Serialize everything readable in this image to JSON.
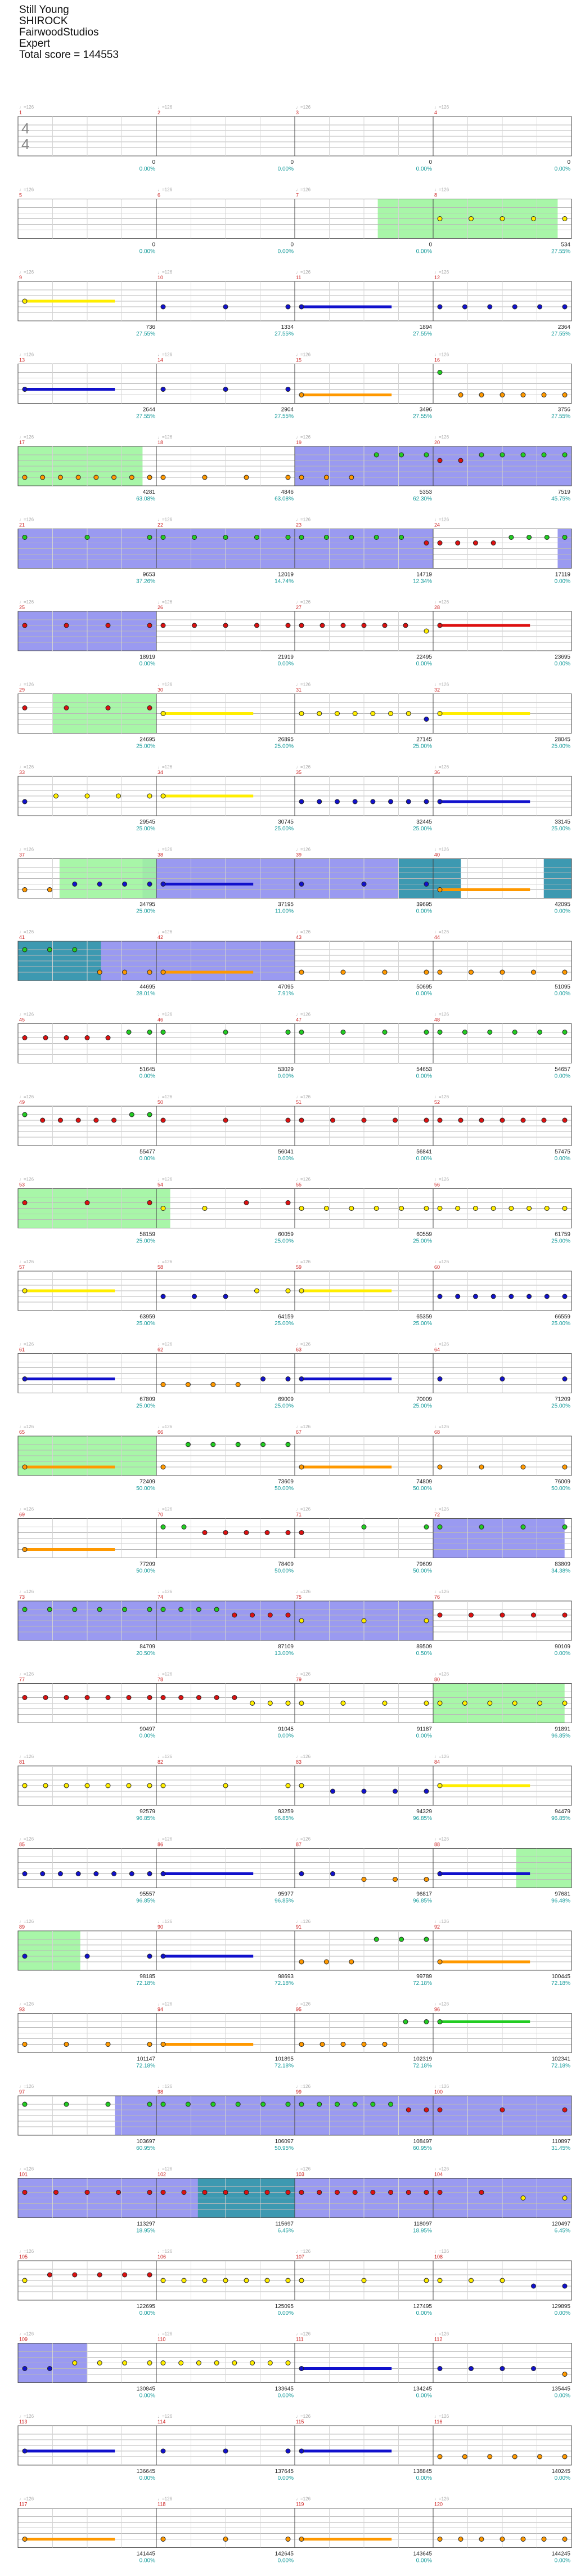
{
  "header": {
    "song_title": "Still Young",
    "artist": "SHIROCK",
    "charter": "FairwoodStudios",
    "difficulty": "Expert",
    "total_score": "Total score = 144553"
  },
  "colors": {
    "green": "#22cc22",
    "red": "#dd1111",
    "yellow": "#ffee00",
    "blue": "#1111cc",
    "orange": "#ff9900",
    "star_power": "#9ef59e",
    "solo": "#8888ee",
    "solo_star": "#3399aa",
    "label_num": "#cc2222",
    "label_bpm": "#aaaaaa",
    "score": "#222222",
    "pct": "#129999"
  },
  "chart_data": {
    "type": "guitar-hero-chart-highway",
    "time_signature": "4/4",
    "measures": [
      {
        "n": 1,
        "bpm": "♩=126",
        "score": "0",
        "pct": "0.00%"
      },
      {
        "n": 2,
        "score": "0",
        "pct": "0.00%"
      },
      {
        "n": 3,
        "bpm": "♩=126",
        "score": "0",
        "pct": "0.00%"
      },
      {
        "n": 4,
        "score": "0",
        "pct": "0.00%"
      },
      {
        "n": 5,
        "score": "0",
        "pct": "0.00%"
      },
      {
        "n": 6,
        "score": "0",
        "pct": "0.00%"
      },
      {
        "n": 7,
        "score": "0",
        "pct": "0.00%"
      },
      {
        "n": 8,
        "score": "534",
        "pct": "27.55%"
      },
      {
        "n": 9,
        "score": "736",
        "pct": "27.55%"
      },
      {
        "n": 10,
        "score": "1334",
        "pct": "27.55%"
      },
      {
        "n": 11,
        "score": "1894",
        "pct": "27.55%"
      },
      {
        "n": 12,
        "score": "2364",
        "pct": "27.55%"
      },
      {
        "n": 13,
        "score": "2644",
        "pct": "27.55%"
      },
      {
        "n": 14,
        "score": "2904",
        "pct": "27.55%"
      },
      {
        "n": 15,
        "score": "3496",
        "pct": "27.55%"
      },
      {
        "n": 16,
        "score": "3756",
        "pct": "27.55%"
      },
      {
        "n": 17,
        "score": "4281",
        "pct": "63.08%"
      },
      {
        "n": 18,
        "score": "4846",
        "pct": "63.08%"
      },
      {
        "n": 19,
        "score": "5353",
        "pct": "62.30%"
      },
      {
        "n": 20,
        "score": "7519",
        "pct": "45.75%"
      },
      {
        "n": 21,
        "score": "9653",
        "pct": "37.26%"
      },
      {
        "n": 22,
        "score": "12019",
        "pct": "14.74%"
      },
      {
        "n": 23,
        "score": "14719",
        "pct": "12.34%"
      },
      {
        "n": 24,
        "score": "17119",
        "pct": "0.00%"
      },
      {
        "n": 25,
        "score": "18919",
        "pct": "0.00%"
      },
      {
        "n": 26,
        "score": "21919",
        "pct": "0.00%"
      },
      {
        "n": 27,
        "score": "22495",
        "pct": "0.00%"
      },
      {
        "n": 28,
        "score": "23695",
        "pct": "0.00%"
      },
      {
        "n": 29,
        "score": "24695",
        "pct": "25.00%"
      },
      {
        "n": 30,
        "score": "26895",
        "pct": "25.00%"
      },
      {
        "n": 31,
        "score": "27145",
        "pct": "25.00%"
      },
      {
        "n": 32,
        "score": "28045",
        "pct": "25.00%"
      },
      {
        "n": 33,
        "score": "29545",
        "pct": "25.00%"
      },
      {
        "n": 34,
        "score": "30745",
        "pct": "25.00%"
      },
      {
        "n": 35,
        "score": "32445",
        "pct": "25.00%"
      },
      {
        "n": 36,
        "score": "33145",
        "pct": "25.00%"
      },
      {
        "n": 37,
        "score": "34795",
        "pct": "25.00%"
      },
      {
        "n": 38,
        "score": "37195",
        "pct": "11.00%"
      },
      {
        "n": 39,
        "score": "39695",
        "pct": "0.00%"
      },
      {
        "n": 40,
        "score": "42095",
        "pct": "0.00%"
      },
      {
        "n": 41,
        "score": "44695",
        "pct": "28.01%"
      },
      {
        "n": 42,
        "score": "47095",
        "pct": "7.91%"
      },
      {
        "n": 43,
        "score": "50695",
        "pct": "0.00%"
      },
      {
        "n": 44,
        "score": "51095",
        "pct": "0.00%"
      },
      {
        "n": 45,
        "score": "51645",
        "pct": "0.00%"
      },
      {
        "n": 46,
        "score": "53029",
        "pct": "0.00%"
      },
      {
        "n": 47,
        "score": "54653",
        "pct": "0.00%"
      },
      {
        "n": 48,
        "score": "54657",
        "pct": "0.00%"
      },
      {
        "n": 49,
        "score": "55477",
        "pct": "0.00%"
      },
      {
        "n": 50,
        "score": "56041",
        "pct": "0.00%"
      },
      {
        "n": 51,
        "score": "56841",
        "pct": "0.00%"
      },
      {
        "n": 52,
        "score": "57475",
        "pct": "0.00%"
      },
      {
        "n": 53,
        "score": "58159",
        "pct": "25.00%"
      },
      {
        "n": 54,
        "score": "60059",
        "pct": "25.00%"
      },
      {
        "n": 55,
        "score": "60559",
        "pct": "25.00%"
      },
      {
        "n": 56,
        "score": "61759",
        "pct": "25.00%"
      },
      {
        "n": 57,
        "score": "63959",
        "pct": "25.00%"
      },
      {
        "n": 58,
        "score": "64159",
        "pct": "25.00%"
      },
      {
        "n": 59,
        "score": "65359",
        "pct": "25.00%"
      },
      {
        "n": 60,
        "score": "66559",
        "pct": "25.00%"
      },
      {
        "n": 61,
        "score": "67809",
        "pct": "25.00%"
      },
      {
        "n": 62,
        "score": "69009",
        "pct": "25.00%"
      },
      {
        "n": 63,
        "score": "70009",
        "pct": "25.00%"
      },
      {
        "n": 64,
        "score": "71209",
        "pct": "25.00%"
      },
      {
        "n": 65,
        "score": "72409",
        "pct": "50.00%"
      },
      {
        "n": 66,
        "score": "73609",
        "pct": "50.00%"
      },
      {
        "n": 67,
        "score": "74809",
        "pct": "50.00%"
      },
      {
        "n": 68,
        "score": "76009",
        "pct": "50.00%"
      },
      {
        "n": 69,
        "score": "77209",
        "pct": "50.00%"
      },
      {
        "n": 70,
        "score": "78409",
        "pct": "50.00%"
      },
      {
        "n": 71,
        "score": "79609",
        "pct": "50.00%"
      },
      {
        "n": 72,
        "score": "83809",
        "pct": "34.38%"
      },
      {
        "n": 73,
        "score": "84709",
        "pct": "20.50%"
      },
      {
        "n": 74,
        "score": "87109",
        "pct": "13.00%"
      },
      {
        "n": 75,
        "score": "89509",
        "pct": "0.50%"
      },
      {
        "n": 76,
        "score": "90109",
        "pct": "0.00%"
      },
      {
        "n": 77,
        "score": "90497",
        "pct": "0.00%"
      },
      {
        "n": 78,
        "score": "91045",
        "pct": "0.00%"
      },
      {
        "n": 79,
        "score": "91187",
        "pct": "0.00%"
      },
      {
        "n": 80,
        "score": "91891",
        "pct": "96.85%"
      },
      {
        "n": 81,
        "score": "92579",
        "pct": "96.85%"
      },
      {
        "n": 82,
        "score": "93259",
        "pct": "96.85%"
      },
      {
        "n": 83,
        "score": "94329",
        "pct": "96.85%"
      },
      {
        "n": 84,
        "score": "94479",
        "pct": "96.85%"
      },
      {
        "n": 85,
        "score": "95557",
        "pct": "96.85%"
      },
      {
        "n": 86,
        "score": "95977",
        "pct": "96.85%"
      },
      {
        "n": 87,
        "score": "96817",
        "pct": "96.85%"
      },
      {
        "n": 88,
        "score": "97681",
        "pct": "96.48%"
      },
      {
        "n": 89,
        "score": "98185",
        "pct": "72.18%"
      },
      {
        "n": 90,
        "score": "98693",
        "pct": "72.18%"
      },
      {
        "n": 91,
        "score": "99789",
        "pct": "72.18%"
      },
      {
        "n": 92,
        "score": "100445",
        "pct": "72.18%"
      },
      {
        "n": 93,
        "score": "101147",
        "pct": "72.18%"
      },
      {
        "n": 94,
        "score": "101895",
        "pct": "72.18%"
      },
      {
        "n": 95,
        "score": "102319",
        "pct": "72.18%"
      },
      {
        "n": 96,
        "score": "102341",
        "pct": "72.18%"
      },
      {
        "n": 97,
        "score": "103697",
        "pct": "60.95%"
      },
      {
        "n": 98,
        "score": "106097",
        "pct": "50.95%"
      },
      {
        "n": 99,
        "score": "108497",
        "pct": "60.95%"
      },
      {
        "n": 100,
        "score": "110897",
        "pct": "31.45%"
      },
      {
        "n": 101,
        "score": "113297",
        "pct": "18.95%"
      },
      {
        "n": 102,
        "score": "115697",
        "pct": "6.45%"
      },
      {
        "n": 103,
        "score": "118097",
        "pct": "18.95%"
      },
      {
        "n": 104,
        "score": "120497",
        "pct": "6.45%"
      },
      {
        "n": 105,
        "score": "122695",
        "pct": "0.00%"
      },
      {
        "n": 106,
        "score": "125095",
        "pct": "0.00%"
      },
      {
        "n": 107,
        "score": "127495",
        "pct": "0.00%"
      },
      {
        "n": 108,
        "score": "129895",
        "pct": "0.00%"
      },
      {
        "n": 109,
        "score": "130845",
        "pct": "0.00%"
      },
      {
        "n": 110,
        "score": "133645",
        "pct": "0.00%"
      },
      {
        "n": 111,
        "score": "134245",
        "pct": "0.00%"
      },
      {
        "n": 112,
        "score": "135445",
        "pct": "0.00%"
      },
      {
        "n": 113,
        "score": "136645",
        "pct": "0.00%"
      },
      {
        "n": 114,
        "score": "137645",
        "pct": "0.00%"
      },
      {
        "n": 115,
        "score": "138845",
        "pct": "0.00%"
      },
      {
        "n": 116,
        "score": "140245",
        "pct": "0.00%"
      },
      {
        "n": 117,
        "score": "141445",
        "pct": "0.00%"
      },
      {
        "n": 118,
        "score": "142645",
        "pct": "0.00%"
      },
      {
        "n": 119,
        "score": "143645",
        "pct": "0.00%"
      },
      {
        "n": 120,
        "score": "144245",
        "pct": "0.00%"
      },
      {
        "n": 121,
        "score": "144553",
        "pct": "0.00%"
      }
    ],
    "bpm_label": "♩=126",
    "special_ranges": {
      "star_power": [
        [
          7.6,
          8.9
        ],
        [
          17.0,
          17.9
        ],
        [
          29.25,
          30.0
        ],
        [
          37.3,
          38.0
        ],
        [
          53.0,
          54.1
        ],
        [
          65.0,
          66.0
        ],
        [
          80.0,
          80.95
        ],
        [
          88.6,
          89.0
        ],
        [
          89.0,
          89.45
        ]
      ],
      "solo": [
        [
          19.0,
          21.0
        ],
        [
          21.0,
          24.0
        ],
        [
          24.9,
          26.0
        ],
        [
          37.9,
          40.2
        ],
        [
          40.8,
          43.0
        ],
        [
          72.0,
          72.95
        ],
        [
          73.0,
          76.0
        ],
        [
          97.7,
          105.0
        ],
        [
          109.0,
          109.5
        ]
      ],
      "solo_star": [
        [
          39.75,
          40.2
        ],
        [
          40.8,
          41.6
        ],
        [
          102.3,
          103.0
        ]
      ]
    }
  }
}
